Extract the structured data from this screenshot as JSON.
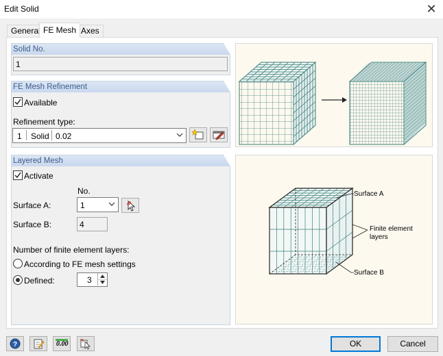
{
  "window": {
    "title": "Edit Solid",
    "close_glyph": "✕"
  },
  "tabs": [
    {
      "label": "General"
    },
    {
      "label": "FE Mesh"
    },
    {
      "label": "Axes"
    }
  ],
  "solid_no": {
    "header": "Solid No.",
    "value": "1"
  },
  "fe_mesh_refinement": {
    "header": "FE Mesh Refinement",
    "available_label": "Available",
    "available_checked": true,
    "refinement_type_label": "Refinement type:",
    "refinement_no": "1",
    "refinement_kind": "Solid",
    "refinement_value": "0.02"
  },
  "layered_mesh": {
    "header": "Layered Mesh",
    "activate_label": "Activate",
    "activate_checked": true,
    "no_label": "No.",
    "surface_a_label": "Surface A:",
    "surface_a_value": "1",
    "surface_b_label": "Surface B:",
    "surface_b_value": "4",
    "num_layers_label": "Number of finite element layers:",
    "according_label": "According to FE mesh settings",
    "defined_label": "Defined:",
    "defined_value": "3",
    "selected_option": "defined"
  },
  "diagram": {
    "surface_a": "Surface A",
    "fe_layers_line1": "Finite element",
    "fe_layers_line2": "layers",
    "surface_b": "Surface B"
  },
  "footer": {
    "ok_label": "OK",
    "cancel_label": "Cancel",
    "units_icon_text": "0.00"
  },
  "colors": {
    "accent": "#0078d7",
    "group_header_text": "#3b5a8a",
    "mesh": "#3a7f7a"
  }
}
